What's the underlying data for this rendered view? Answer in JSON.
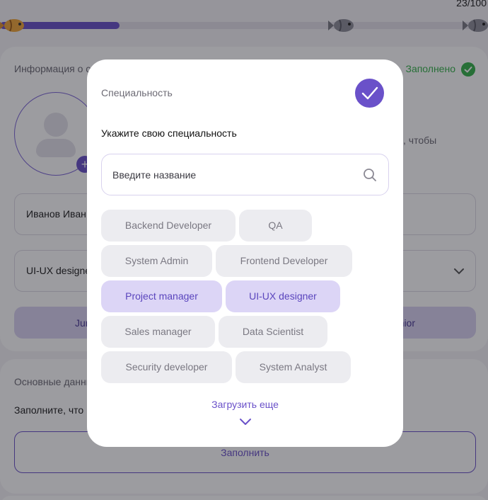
{
  "progress": {
    "counter": "23/100",
    "value_fraction": 0.245
  },
  "info_card": {
    "title": "Информация о себе",
    "status": "Заполнено",
    "hint": ", чтобы",
    "name_value": "Иванов Иван",
    "specialty_value": "UI-UX designer",
    "level_left": "Junior",
    "level_right": "Senior"
  },
  "main_card": {
    "title": "Основные данные",
    "description": "Заполните, что",
    "fill_button": "Заполнить"
  },
  "modal": {
    "title": "Специальность",
    "label": "Укажите свою специальность",
    "search_placeholder": "Введите название",
    "chips": [
      {
        "label": "Backend Developer",
        "selected": false
      },
      {
        "label": "QA",
        "selected": false
      },
      {
        "label": "System Admin",
        "selected": false
      },
      {
        "label": "Frontend Developer",
        "selected": false
      },
      {
        "label": "Project manager",
        "selected": true
      },
      {
        "label": "UI-UX designer",
        "selected": true
      },
      {
        "label": "Sales manager",
        "selected": false
      },
      {
        "label": "Data Scientist",
        "selected": false
      },
      {
        "label": "Security developer",
        "selected": false
      },
      {
        "label": "System Analyst",
        "selected": false
      }
    ],
    "load_more": "Загрузить еще"
  },
  "colors": {
    "accent": "#6a51c9",
    "success": "#36b24a",
    "chip": "#ececf0",
    "chip_selected": "#dcd5f6"
  },
  "icons": [
    "fish-icon",
    "check-icon",
    "search-icon",
    "chevron-down-icon",
    "plus-icon",
    "user-placeholder-icon"
  ]
}
